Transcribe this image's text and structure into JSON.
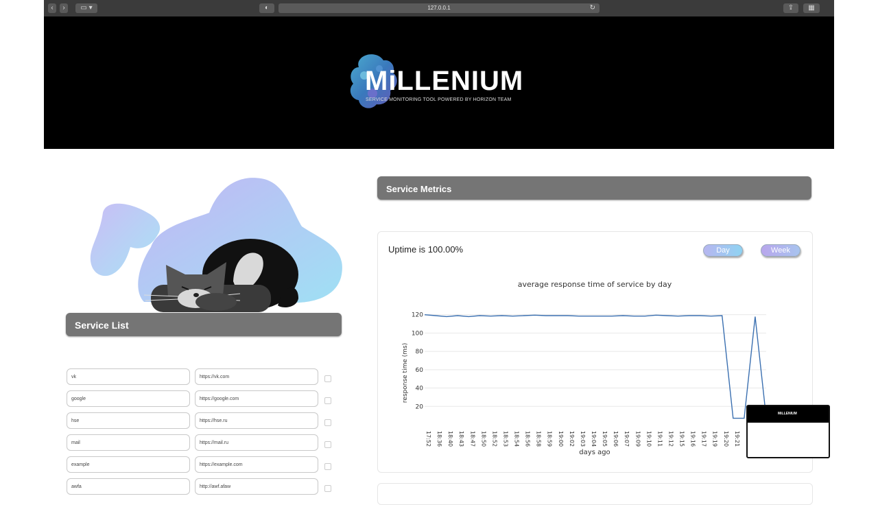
{
  "browser": {
    "url": "127.0.0.1"
  },
  "header": {
    "title": "MiLLENIUM",
    "subtitle": "SERVICE MONITORING TOOL POWERED BY HORIZON TEAM"
  },
  "service_list": {
    "title": "Service List",
    "rows": [
      {
        "name": "vk",
        "url": "https://vk.com"
      },
      {
        "name": "google",
        "url": "https://google.com"
      },
      {
        "name": "hse",
        "url": "https://hse.ru"
      },
      {
        "name": "mail",
        "url": "https://mail.ru"
      },
      {
        "name": "example",
        "url": "https://example.com"
      },
      {
        "name": "awfa",
        "url": "http://awf.afaw"
      }
    ]
  },
  "metrics": {
    "title": "Service Metrics",
    "uptime": "Uptime is 100.00%",
    "day_button": "Day",
    "week_button": "Week"
  },
  "thumbnail": {
    "title": "MiLLENIUM"
  },
  "colors": {
    "line": "#3a6fb0",
    "header_bg": "#000000",
    "bar_bg": "#757575"
  },
  "chart_data": {
    "type": "line",
    "title": "average response time of service by day",
    "xlabel": "days ago",
    "ylabel": "response time (ms)",
    "yticks": [
      120,
      100,
      80,
      60,
      40,
      20
    ],
    "ylim": [
      0,
      125
    ],
    "grid": true,
    "x": [
      "17:52",
      "18:36",
      "18:40",
      "18:43",
      "18:47",
      "18:50",
      "18:52",
      "18:53",
      "18:54",
      "18:56",
      "18:58",
      "18:59",
      "19:00",
      "19:02",
      "19:03",
      "19:04",
      "19:05",
      "19:06",
      "19:07",
      "19:09",
      "19:10",
      "19:11",
      "19:12",
      "19:15",
      "19:16",
      "19:17",
      "19:19",
      "19:20",
      "19:21",
      "21:51",
      "22:51"
    ],
    "series": [
      {
        "values": [
          120,
          119,
          118,
          119,
          118,
          119,
          118.5,
          119,
          118.5,
          119,
          119.5,
          119,
          119,
          119,
          118.5,
          118.5,
          118.5,
          118.5,
          119,
          118.5,
          118.5,
          119.5,
          119,
          118.5,
          119,
          119,
          118.5,
          119,
          7,
          7,
          118,
          8
        ]
      }
    ]
  }
}
